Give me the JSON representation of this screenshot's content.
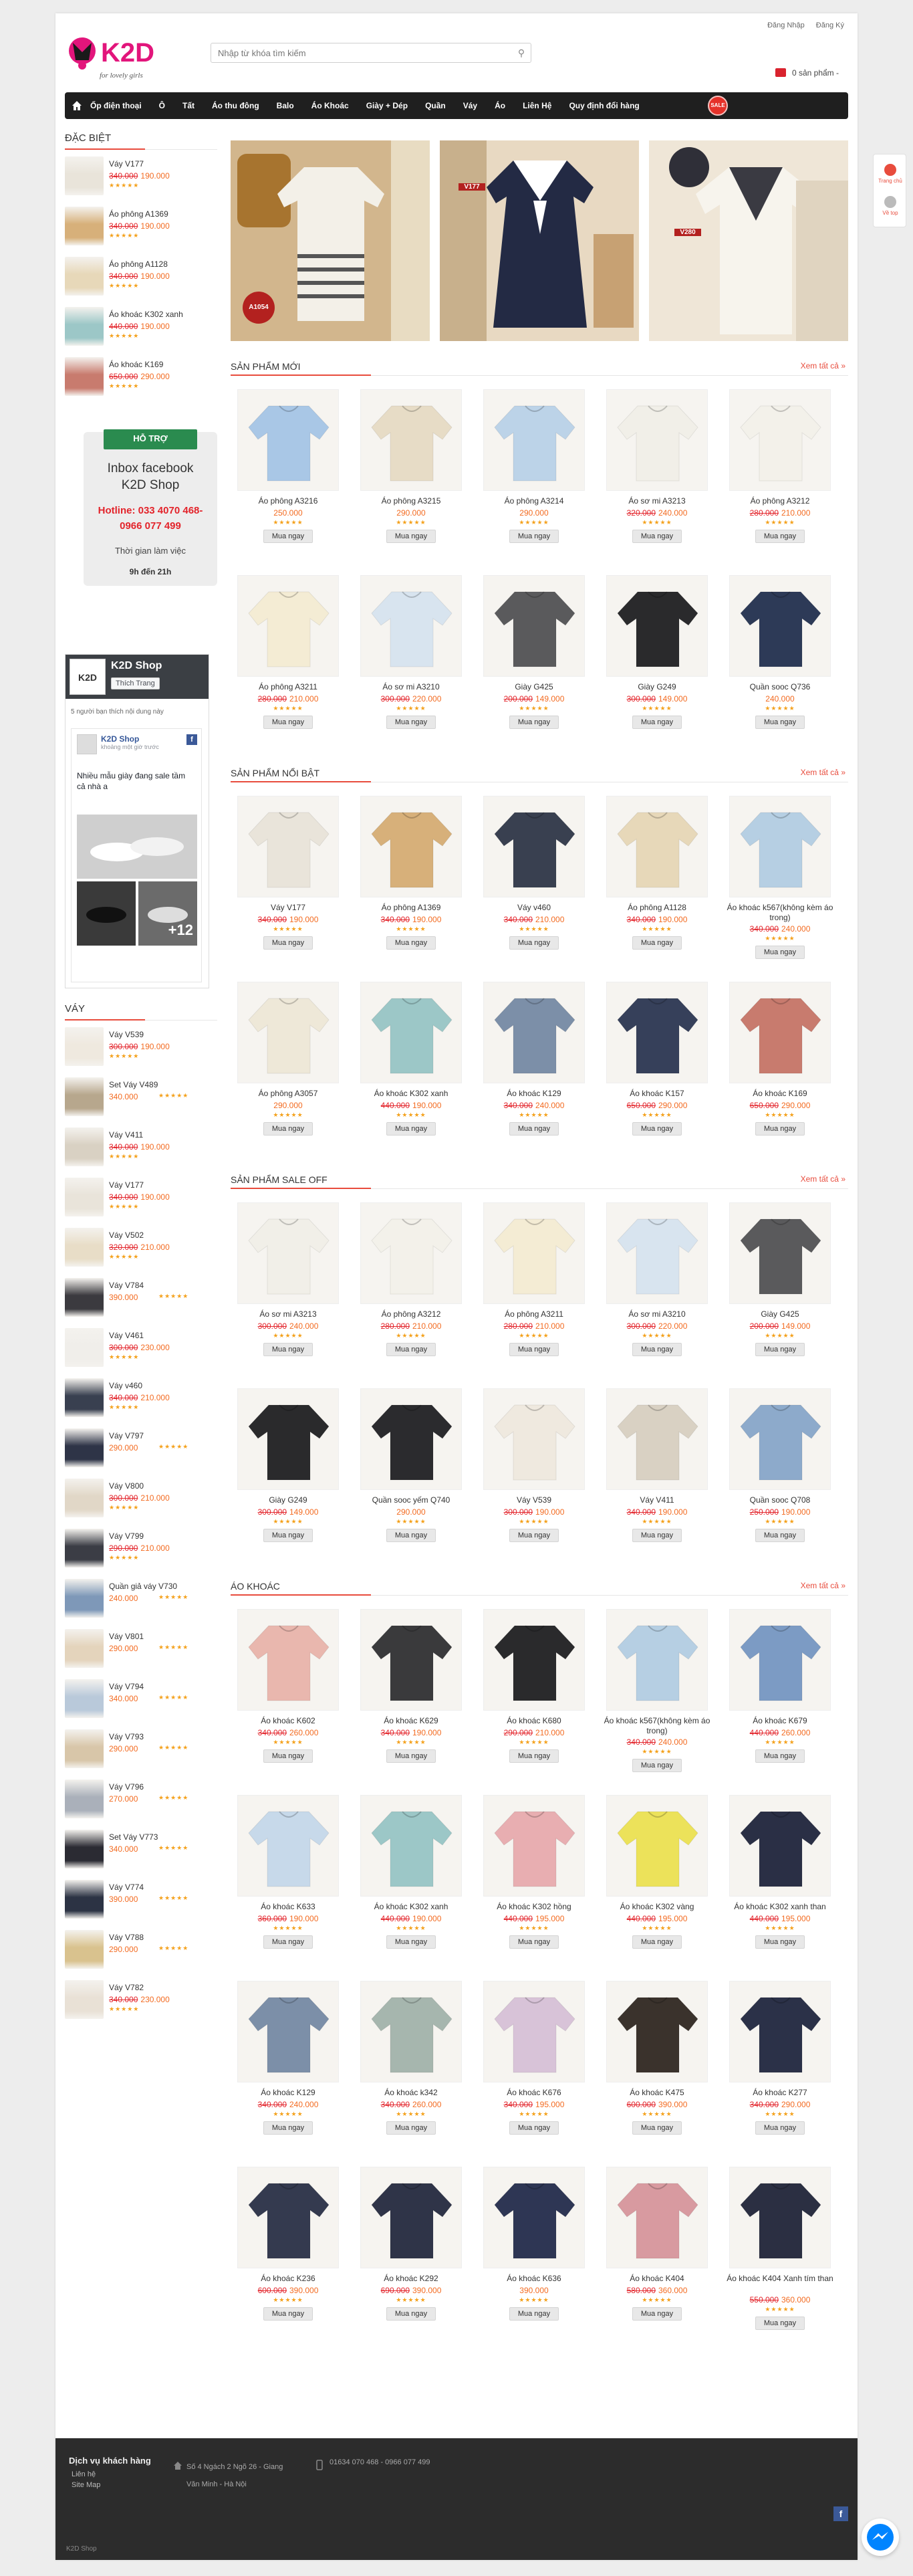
{
  "header": {
    "logo_text": "K2D",
    "logo_tagline": "for lovely girls",
    "search_placeholder": "Nhập từ khóa tìm kiếm",
    "login": "Đăng Nhập",
    "register": "Đăng Ký",
    "cart_text": "0 sản phẩm -"
  },
  "nav": {
    "items": [
      "Ốp điện thoại",
      "Ô",
      "Tất",
      "Áo thu đông",
      "Balo",
      "Áo Khoác",
      "Giày + Dép",
      "Quần",
      "Váy",
      "Áo",
      "Liên Hệ",
      "Quy định đổi hàng"
    ],
    "flag": "SALE"
  },
  "right_float": {
    "home": "Trang chủ",
    "top": "Về top"
  },
  "specials": {
    "title": "ĐẶC BIỆT",
    "items": [
      {
        "name": "Váy V177",
        "old": "340.000",
        "new": "190.000",
        "color": "#e9e4da"
      },
      {
        "name": "Áo phông A1369",
        "old": "340.000",
        "new": "190.000",
        "color": "#d7b07a"
      },
      {
        "name": "Áo phông A1128",
        "old": "340.000",
        "new": "190.000",
        "color": "#e7d8b9"
      },
      {
        "name": "Áo khoác K302 xanh",
        "old": "440.000",
        "new": "190.000",
        "color": "#9cc7c7"
      },
      {
        "name": "Áo khoác K169",
        "old": "650.000",
        "new": "290.000",
        "color": "#c87b6e"
      }
    ]
  },
  "support": {
    "ribbon": "HỖ TRỢ",
    "fb_line1": "Inbox facebook",
    "fb_line2": "K2D Shop",
    "hotline1": "Hotline: 033 4070 468-",
    "hotline2": "0966 077 499",
    "time_label": "Thời gian làm việc",
    "hours": "9h đến 21h"
  },
  "fb": {
    "logo": "K2D",
    "page_name": "K2D Shop",
    "like": "Thích Trang",
    "people": "5 người bạn thích nội dung này",
    "post_name": "K2D Shop",
    "post_time": "khoảng một giờ trước",
    "post_text": "Nhiều mẫu giày đang sale tầm cả nhà a",
    "more": "+12"
  },
  "vay": {
    "title": "VÁY",
    "items": [
      {
        "name": "Váy V539",
        "old": "300.000",
        "new": "190.000",
        "color": "#efe9df"
      },
      {
        "name": "Set Váy V489",
        "old": "",
        "new": "340.000",
        "color": "#b7a78d"
      },
      {
        "name": "Váy V411",
        "old": "340.000",
        "new": "190.000",
        "color": "#d9d1c3"
      },
      {
        "name": "Váy V177",
        "old": "340.000",
        "new": "190.000",
        "color": "#e9e4da"
      },
      {
        "name": "Váy V502",
        "old": "320.000",
        "new": "210.000",
        "color": "#e8ddc7"
      },
      {
        "name": "Váy V784",
        "old": "",
        "new": "390.000",
        "color": "#3b3a3f"
      },
      {
        "name": "Váy V461",
        "old": "300.000",
        "new": "230.000",
        "color": "#f0eeea"
      },
      {
        "name": "Váy v460",
        "old": "340.000",
        "new": "210.000",
        "color": "#394050"
      },
      {
        "name": "Váy V797",
        "old": "",
        "new": "290.000",
        "color": "#2e3447"
      },
      {
        "name": "Váy V800",
        "old": "300.000",
        "new": "210.000",
        "color": "#e1d7c7"
      },
      {
        "name": "Váy V799",
        "old": "290.000",
        "new": "210.000",
        "color": "#3b3d45"
      },
      {
        "name": "Quần giả váy V730",
        "old": "",
        "new": "240.000",
        "color": "#7e98b8"
      },
      {
        "name": "Váy V801",
        "old": "",
        "new": "290.000",
        "color": "#e4d4bc"
      },
      {
        "name": "Váy V794",
        "old": "",
        "new": "340.000",
        "color": "#b9c9da"
      },
      {
        "name": "Váy V793",
        "old": "",
        "new": "290.000",
        "color": "#d8c6a9"
      },
      {
        "name": "Váy V796",
        "old": "",
        "new": "270.000",
        "color": "#aab0ba"
      },
      {
        "name": "Set Váy V773",
        "old": "",
        "new": "340.000",
        "color": "#2b2b33"
      },
      {
        "name": "Váy V774",
        "old": "",
        "new": "390.000",
        "color": "#2c3344"
      },
      {
        "name": "Váy V788",
        "old": "",
        "new": "290.000",
        "color": "#d9c28e"
      },
      {
        "name": "Váy V782",
        "old": "340.000",
        "new": "230.000",
        "color": "#e9e1d6"
      }
    ]
  },
  "slides": [
    {
      "tag": "A1054",
      "color": "#c9a779"
    },
    {
      "tag": "V177",
      "color": "#d8c7ae"
    },
    {
      "tag": "V280",
      "color": "#e3d8c6"
    }
  ],
  "sections": [
    {
      "title": "SẢN PHẨM MỚI",
      "see_all": "Xem tất cả »",
      "buy": "Mua ngay",
      "products": [
        {
          "name": "Áo phông A3216",
          "old": "",
          "new": "250.000",
          "color": "#a9c7e6"
        },
        {
          "name": "Áo phông A3215",
          "old": "",
          "new": "290.000",
          "color": "#e7dcc6"
        },
        {
          "name": "Áo phông A3214",
          "old": "",
          "new": "290.000",
          "color": "#bcd3e8"
        },
        {
          "name": "Áo sơ mi A3213",
          "old": "320.000",
          "new": "240.000",
          "color": "#f1efe8"
        },
        {
          "name": "Áo phông A3212",
          "old": "280.000",
          "new": "210.000",
          "color": "#f3f1ea"
        },
        {
          "name": "Áo phông A3211",
          "old": "280.000",
          "new": "210.000",
          "color": "#f4ecd4"
        },
        {
          "name": "Áo sơ mi A3210",
          "old": "300.000",
          "new": "220.000",
          "color": "#d8e4ef"
        },
        {
          "name": "Giày G425",
          "old": "200.000",
          "new": "149.000",
          "color": "#5a5a5c"
        },
        {
          "name": "Giày G249",
          "old": "300.000",
          "new": "149.000",
          "color": "#2a2a2c"
        },
        {
          "name": "Quần sooc Q736",
          "old": "",
          "new": "240.000",
          "color": "#2d3a57"
        }
      ]
    },
    {
      "title": "SẢN PHẨM NỔI BẬT",
      "see_all": "Xem tất cả »",
      "buy": "Mua ngay",
      "products": [
        {
          "name": "Váy V177",
          "old": "340.000",
          "new": "190.000",
          "color": "#e9e4da"
        },
        {
          "name": "Áo phông A1369",
          "old": "340.000",
          "new": "190.000",
          "color": "#d7b07a"
        },
        {
          "name": "Váy v460",
          "old": "340.000",
          "new": "210.000",
          "color": "#394050"
        },
        {
          "name": "Áo phông A1128",
          "old": "340.000",
          "new": "190.000",
          "color": "#e7d8b9"
        },
        {
          "name": "Áo khoác k567(không kèm áo trong)",
          "old": "340.000",
          "new": "240.000",
          "color": "#b6cfe3"
        },
        {
          "name": "Áo phông A3057",
          "old": "",
          "new": "290.000",
          "color": "#eee8d8"
        },
        {
          "name": "Áo khoác K302 xanh",
          "old": "440.000",
          "new": "190.000",
          "color": "#9cc7c7"
        },
        {
          "name": "Áo khoác K129",
          "old": "340.000",
          "new": "240.000",
          "color": "#7c8fa8"
        },
        {
          "name": "Áo khoác K157",
          "old": "650.000",
          "new": "290.000",
          "color": "#36405a"
        },
        {
          "name": "Áo khoác K169",
          "old": "650.000",
          "new": "290.000",
          "color": "#c87b6e"
        }
      ]
    },
    {
      "title": "SẢN PHẨM SALE OFF",
      "see_all": "Xem tất cả »",
      "buy": "Mua ngay",
      "products": [
        {
          "name": "Áo sơ mi A3213",
          "old": "300.000",
          "new": "240.000",
          "color": "#f1efe8"
        },
        {
          "name": "Áo phông A3212",
          "old": "280.000",
          "new": "210.000",
          "color": "#f3f1ea"
        },
        {
          "name": "Áo phông A3211",
          "old": "280.000",
          "new": "210.000",
          "color": "#f4ecd4"
        },
        {
          "name": "Áo sơ mi A3210",
          "old": "300.000",
          "new": "220.000",
          "color": "#d8e4ef"
        },
        {
          "name": "Giày G425",
          "old": "200.000",
          "new": "149.000",
          "color": "#5a5a5c"
        },
        {
          "name": "Giày G249",
          "old": "300.000",
          "new": "149.000",
          "color": "#2a2a2c"
        },
        {
          "name": "Quần sooc yếm Q740",
          "old": "",
          "new": "290.000",
          "color": "#2b2b2e"
        },
        {
          "name": "Váy V539",
          "old": "300.000",
          "new": "190.000",
          "color": "#efe9df"
        },
        {
          "name": "Váy V411",
          "old": "340.000",
          "new": "190.000",
          "color": "#d9d1c3"
        },
        {
          "name": "Quần sooc Q708",
          "old": "250.000",
          "new": "190.000",
          "color": "#8daacb"
        }
      ]
    },
    {
      "title": "ÁO KHOÁC",
      "see_all": "Xem tất cả »",
      "buy": "Mua ngay",
      "products": [
        {
          "name": "Áo khoác K602",
          "old": "340.000",
          "new": "260.000",
          "color": "#e9b7ae"
        },
        {
          "name": "Áo khoác K629",
          "old": "340.000",
          "new": "190.000",
          "color": "#3a3a3c"
        },
        {
          "name": "Áo khoác K680",
          "old": "290.000",
          "new": "210.000",
          "color": "#2a2a2c"
        },
        {
          "name": "Áo khoác k567(không kèm áo trong)",
          "old": "340.000",
          "new": "240.000",
          "color": "#b6cfe3"
        },
        {
          "name": "Áo khoác K679",
          "old": "440.000",
          "new": "260.000",
          "color": "#7c9bc4"
        },
        {
          "name": "Áo khoác K633",
          "old": "360.000",
          "new": "190.000",
          "color": "#c7d9ea"
        },
        {
          "name": "Áo khoác K302 xanh",
          "old": "440.000",
          "new": "190.000",
          "color": "#9cc7c7"
        },
        {
          "name": "Áo khoác K302 hồng",
          "old": "440.000",
          "new": "195.000",
          "color": "#e8aeb1"
        },
        {
          "name": "Áo khoác K302 vàng",
          "old": "440.000",
          "new": "195.000",
          "color": "#ece25a"
        },
        {
          "name": "Áo khoác K302 xanh than",
          "old": "440.000",
          "new": "195.000",
          "color": "#2a2f45"
        },
        {
          "name": "Áo khoác K129",
          "old": "340.000",
          "new": "240.000",
          "color": "#7c8fa8"
        },
        {
          "name": "Áo khoác k342",
          "old": "340.000",
          "new": "260.000",
          "color": "#a6b6ae"
        },
        {
          "name": "Áo khoác K676",
          "old": "340.000",
          "new": "195.000",
          "color": "#d8c3d8"
        },
        {
          "name": "Áo khoác K475",
          "old": "600.000",
          "new": "390.000",
          "color": "#3a322c"
        },
        {
          "name": "Áo khoác K277",
          "old": "340.000",
          "new": "290.000",
          "color": "#2b3148"
        },
        {
          "name": "Áo khoác K236",
          "old": "600.000",
          "new": "390.000",
          "color": "#343a4f"
        },
        {
          "name": "Áo khoác K292",
          "old": "690.000",
          "new": "390.000",
          "color": "#2f3448"
        },
        {
          "name": "Áo khoác K636",
          "old": "",
          "new": "390.000",
          "color": "#2e3654"
        },
        {
          "name": "Áo khoác K404",
          "old": "580.000",
          "new": "360.000",
          "color": "#d89aa0"
        },
        {
          "name": "Áo khoác K404 Xanh tím than",
          "old": "550.000",
          "new": "360.000",
          "color": "#2b2f42"
        }
      ]
    }
  ],
  "footer": {
    "title": "Dịch vụ khách hàng",
    "links": [
      "Liên hệ",
      "Site Map"
    ],
    "address1": "Số 4 Ngách 2 Ngõ 26 - Giang",
    "address2": "Văn Minh - Hà Nội",
    "phone": "01634 070 468 - 0966 077 499",
    "fb": "f",
    "copy": "K2D Shop"
  },
  "stars": "★★★★★"
}
